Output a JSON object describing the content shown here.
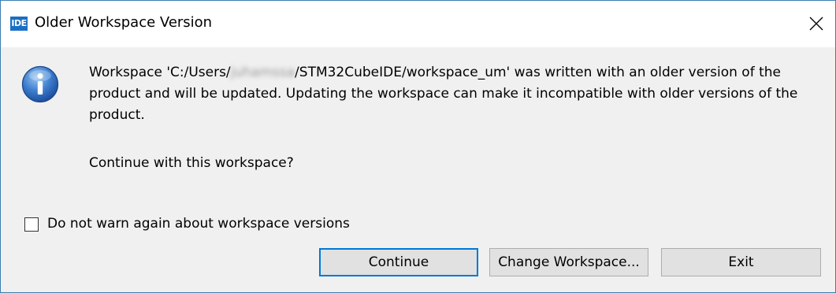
{
  "window": {
    "app_icon_text": "IDE",
    "title": "Older Workspace Version"
  },
  "dialog": {
    "message_prefix": "Workspace 'C:/Users/",
    "redacted_user": "juhamssa",
    "message_suffix": "/STM32CubeIDE/workspace_um' was written with an older version of the product and will be updated. Updating the workspace can make it incompatible with older versions of the product.",
    "question": "Continue with this workspace?",
    "checkbox_label": "Do not warn again about workspace versions",
    "checkbox_checked": false
  },
  "buttons": {
    "continue": "Continue",
    "change_workspace": "Change Workspace...",
    "exit": "Exit"
  },
  "colors": {
    "accent": "#0078d7",
    "icon_blue": "#1a6fc4",
    "window_border": "#3c7fb1"
  }
}
